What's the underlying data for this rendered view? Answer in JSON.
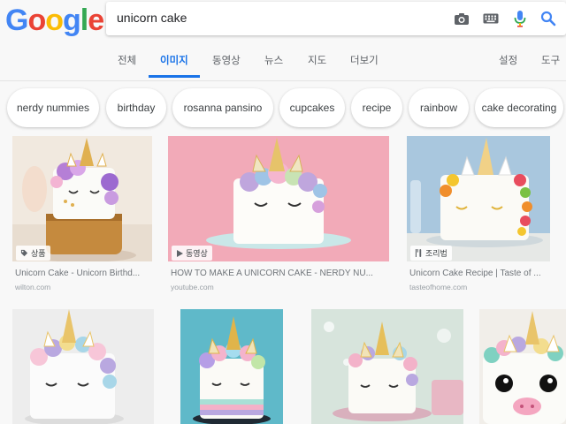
{
  "header": {
    "logo_letters": [
      "G",
      "o",
      "o",
      "g",
      "l",
      "e"
    ],
    "search_query": "unicorn cake"
  },
  "tabs": [
    "전체",
    "이미지",
    "동영상",
    "뉴스",
    "지도",
    "더보기"
  ],
  "right_tabs": [
    "설정",
    "도구"
  ],
  "chips": [
    "nerdy nummies",
    "birthday",
    "rosanna pansino",
    "cupcakes",
    "recipe",
    "rainbow",
    "cake decorating"
  ],
  "results": [
    {
      "badge": "상품",
      "title": "Unicorn Cake - Unicorn Birthd...",
      "source": "wilton.com"
    },
    {
      "badge": "동영상",
      "title": "HOW TO MAKE A UNICORN CAKE - NERDY NU...",
      "source": "youtube.com"
    },
    {
      "badge": "조리법",
      "title": "Unicorn Cake Recipe | Taste of ...",
      "source": "tasteofhome.com"
    }
  ],
  "colors": {
    "accent": "#1a73e8",
    "google_blue": "#4285f4",
    "google_red": "#ea4335",
    "google_yellow": "#fbbc05",
    "google_green": "#34a853"
  },
  "icons": [
    "camera-icon",
    "keyboard-icon",
    "microphone-icon",
    "search-icon",
    "tag-icon",
    "play-icon",
    "utensils-icon"
  ]
}
